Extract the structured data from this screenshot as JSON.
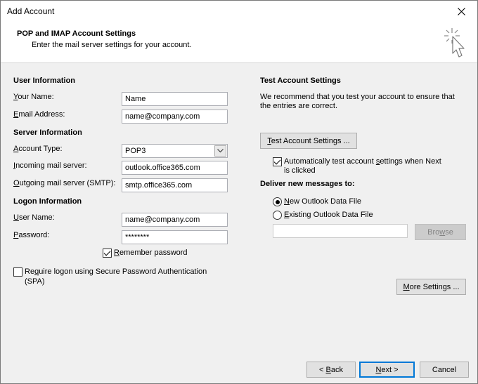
{
  "window": {
    "title": "Add Account"
  },
  "header": {
    "title": "POP and IMAP Account Settings",
    "subtitle": "Enter the mail server settings for your account."
  },
  "user_info": {
    "heading": "User Information",
    "your_name_label": "Your Name:",
    "your_name_value": "Name",
    "email_label": "Email Address:",
    "email_value": "name@company.com"
  },
  "server_info": {
    "heading": "Server Information",
    "account_type_label": "Account Type:",
    "account_type_value": "POP3",
    "incoming_label": "Incoming mail server:",
    "incoming_value": "outlook.office365.com",
    "outgoing_label": "Outgoing mail server (SMTP):",
    "outgoing_value": "smtp.office365.com"
  },
  "logon_info": {
    "heading": "Logon Information",
    "username_label": "User Name:",
    "username_value": "name@company.com",
    "password_label": "Password:",
    "password_value": "********",
    "remember_label": "Remember password",
    "remember_checked": true,
    "spa_label_line1": "Require logon using Secure Password Authentication",
    "spa_label_line2": "(SPA)",
    "spa_checked": false
  },
  "test_settings": {
    "heading": "Test Account Settings",
    "description_line1": "We recommend that you test your account to ensure that",
    "description_line2": "the entries are correct.",
    "test_button": "Test Account Settings ...",
    "auto_test_line1": "Automatically test account settings when Next",
    "auto_test_line2": "is clicked",
    "auto_test_checked": true
  },
  "deliver": {
    "heading": "Deliver new messages to:",
    "option_new": "New Outlook Data File",
    "option_existing": "Existing Outlook Data File",
    "selected": "new",
    "existing_path_value": "",
    "browse_button": "Browse"
  },
  "buttons": {
    "more_settings": "More Settings ...",
    "back": "< Back",
    "next": "Next >",
    "cancel": "Cancel"
  },
  "colors": {
    "accent": "#0078d7",
    "dialog_bg": "#f0f0f0",
    "header_bg": "#ffffff"
  },
  "icons": {
    "close": "close-icon",
    "wizard": "cursor-sparkle-icon",
    "dropdown": "chevron-down-icon"
  }
}
